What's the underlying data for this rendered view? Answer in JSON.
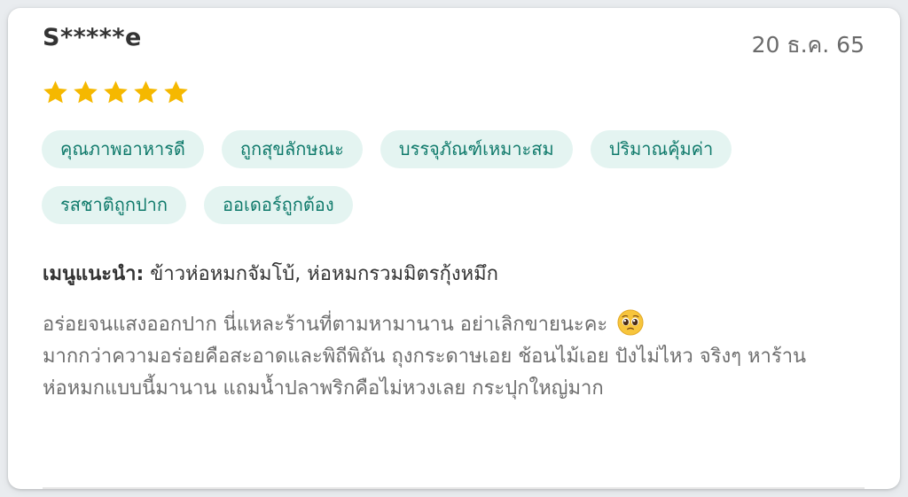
{
  "review": {
    "reviewer_name": "S*****e",
    "date": "20 ธ.ค. 65",
    "rating": 5,
    "max_rating": 5,
    "star_color": "#F5B800",
    "tags_row1": [
      "คุณภาพอาหารดี",
      "ถูกสุขลักษณะ",
      "บรรจุภัณฑ์เหมาะสม",
      "ปริมาณคุ้มค่า"
    ],
    "tags_row2": [
      "รสชาติถูกปาก",
      "ออเดอร์ถูกต้อง"
    ],
    "recommended_label": "เมนูแนะนำ:",
    "recommended_items": "ข้าวห่อหมกจัมโบ้, ห่อหมกรวมมิตรกุ้งหมึก",
    "text_part1": "อร่อยจนแสงออกปาก นี่แหละร้านที่ตามหามานาน อย่าเลิกขายนะคะ",
    "emoji_icon": "pleading-face-emoji",
    "text_part2": "มากกว่าความอร่อยคือสะอาดและพิถีพิถัน ถุงกระดาษเอย ช้อนไม้เอย ปังไม่ไหว จริงๆ หาร้านห่อหมกแบบนี้มานาน แถมน้ำปลาพริกคือไม่หวงเลย กระปุกใหญ่มาก"
  }
}
